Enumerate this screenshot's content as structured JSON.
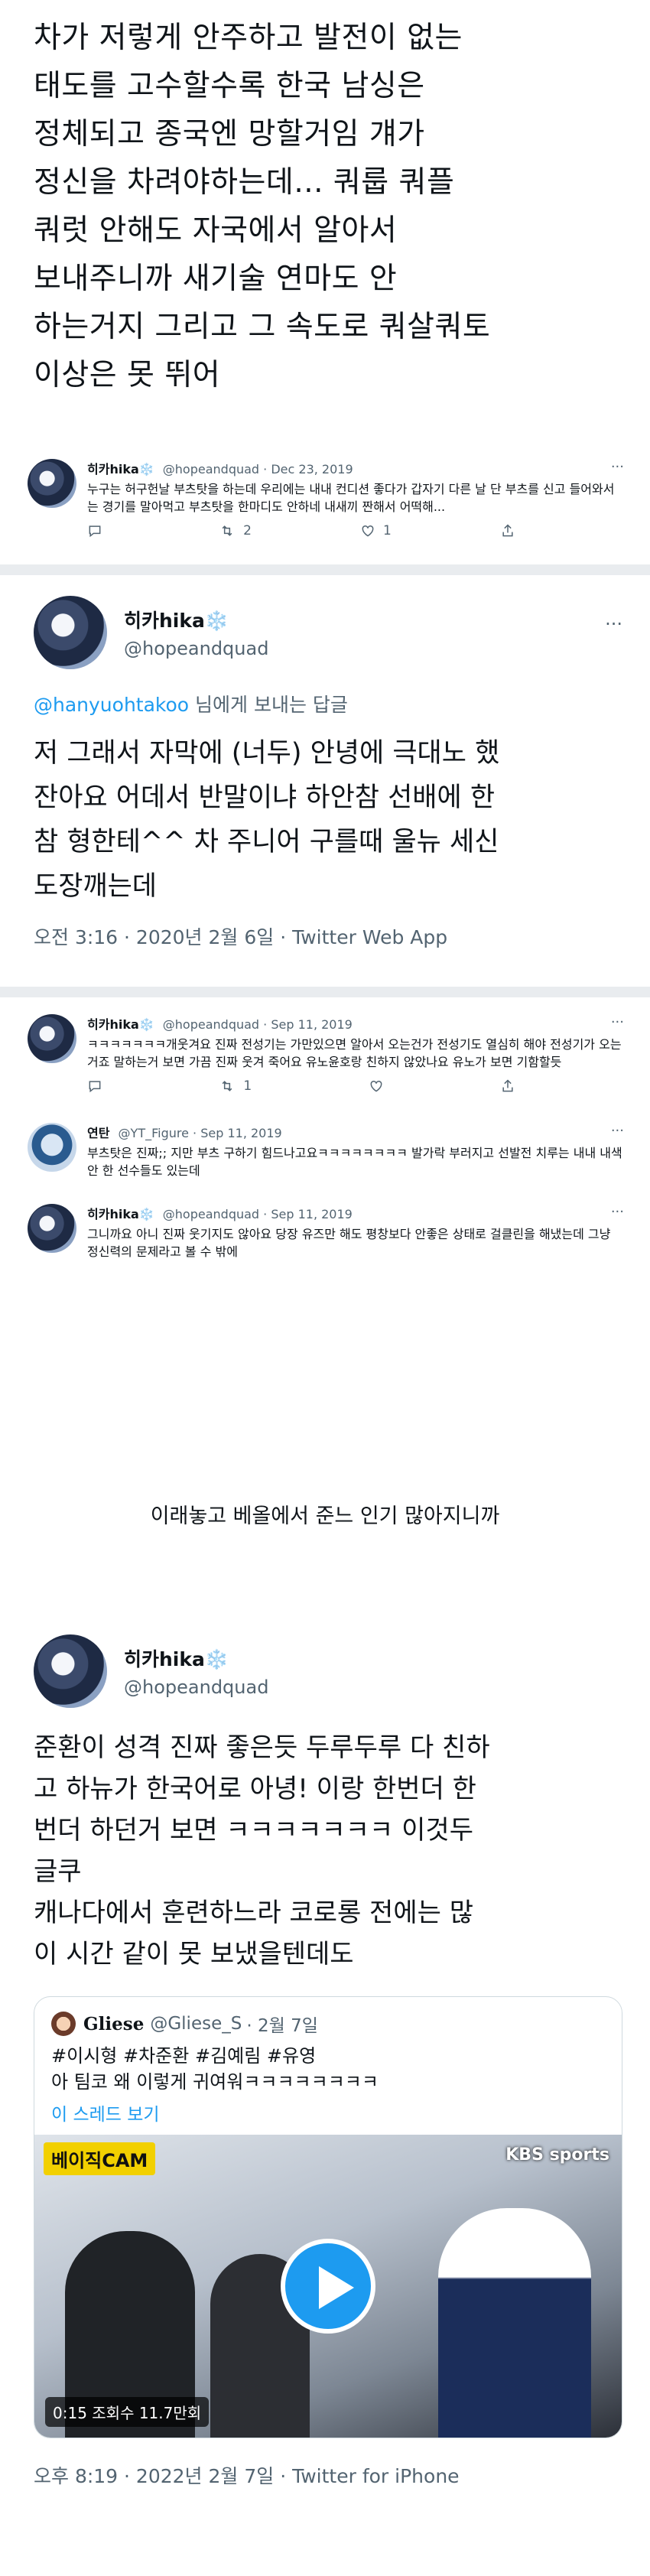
{
  "top_tweet": {
    "text": "차가 저렇게 안주하고 발전이 없는\n태도를 고수할수록 한국 남싱은\n정체되고 종국엔 망할거임 걔가\n정신을 차려야하는데... 쿼룹 쿼플\n쿼럿 안해도 자국에서 알아서\n보내주니까 새기술 연마도 안\n하는거지 그리고 그 속도로 쿼살쿼토\n이상은 못 뛰어"
  },
  "reply1": {
    "name": "히카hika❄️",
    "handle": "@hopeandquad",
    "date": "· Dec 23, 2019",
    "text": "누구는 허구헌날 부츠탓을 하는데 우리에는 내내 컨디션 좋다가 갑자기 다른 날 단 부츠를 신고 들어와서는 경기를 말아먹고 부츠탓을 한마디도 안하네 내새끼 짠해서 어떡해...",
    "replies": "",
    "retweets": "2",
    "likes": "1"
  },
  "main_tweet": {
    "name": "히카hika❄️",
    "handle": "@hopeandquad",
    "reply_to": "@hanyuohtakoo",
    "reply_suffix": " 님에게 보내는 답글",
    "text": "저 그래서 자막에 (너두) 안녕에 극대노 했\n잔아요 어데서 반말이냐 하안참 선배에 한\n참 형한테^^ 차 주니어 구를때 울뉴 세신\n도장깨는데",
    "meta": "오전 3:16 · 2020년 2월 6일 · Twitter Web App"
  },
  "thread2": [
    {
      "name": "히카hika❄️",
      "handle": "@hopeandquad",
      "date": "· Sep 11, 2019",
      "text": "ㅋㅋㅋㅋㅋㅋㅋ개웃겨요 진짜 전성기는 가만있으면 알아서 오는건가 전성기도 열심히 해야 전성기가 오는거죠 말하는거 보면 가끔 진짜 웃겨 죽어요 유노윤호랑 친하지 않았나요 유노가 보면 기함할듯",
      "retweets": "1",
      "likes": ""
    },
    {
      "name": "연탄",
      "handle": "@YT_Figure",
      "date": "· Sep 11, 2019",
      "text": "부츠탓은 진짜;; 지만 부츠 구하기 힘드나고요ㅋㅋㅋㅋㅋㅋㅋㅋ 발가락 부러지고 선발전 치루는 내내 내색 안 한 선수들도 있는데",
      "retweets": "",
      "likes": ""
    },
    {
      "name": "히카hika❄️",
      "handle": "@hopeandquad",
      "date": "· Sep 11, 2019",
      "text": "그니까요 아니 진짜 웃기지도 않아요 당장 유즈만 해도 평창보다 안좋은 상태로 걸클린을 해냈는데 그냥 정신력의 문제라고 볼 수 밖에",
      "retweets": "",
      "likes": ""
    }
  ],
  "caption": "이래놓고 베올에서 준느 인기 많아지니까",
  "last_tweet": {
    "name": "히카hika❄️",
    "handle": "@hopeandquad",
    "text": "준환이 성격 진짜 좋은듯 두루두루 다 친하\n고 하뉴가 한국어로 아녕! 이랑 한번더 한\n번더 하던거 보면 ㅋㅋㅋㅋㅋㅋㅋ 이것두\n글쿠\n캐나다에서 훈련하느라 코로롱 전에는 많\n이 시간 같이 못 보냈을텐데도",
    "quote": {
      "name": "Gliese",
      "handle": "@Gliese_S",
      "date": "· 2월 7일",
      "text": "#이시형 #차준환 #김예림 #유영\n아 팀코 왜 이렇게 귀여워ㅋㅋㅋㅋㅋㅋㅋㅋ",
      "more": "이 스레드 보기",
      "video_brand": "베이직CAM",
      "video_channel": "KBS sports",
      "video_info": "0:15  조회수 11.7만회"
    },
    "meta": "오후 8:19 · 2022년 2월 7일 · Twitter for iPhone"
  },
  "icons": {
    "reply": "reply-icon",
    "retweet": "retweet-icon",
    "like": "heart-icon",
    "share": "share-icon",
    "more": "more-icon"
  },
  "colors": {
    "accent": "#1d9bf0",
    "muted": "#536471",
    "divider": "#e9ecef"
  }
}
